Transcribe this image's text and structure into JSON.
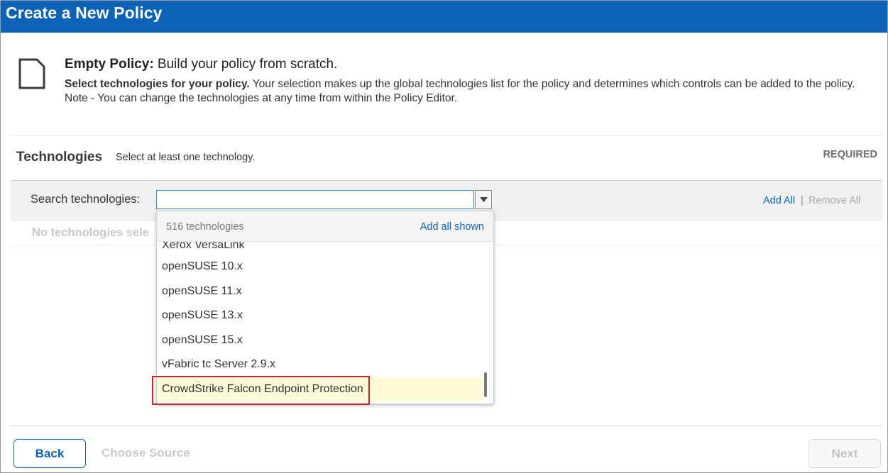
{
  "window": {
    "title": "Create a New Policy"
  },
  "intro": {
    "heading_bold": "Empty Policy:",
    "heading_rest": " Build your policy from scratch.",
    "body_bold": "Select technologies for your policy.",
    "body_rest": " Your selection makes up the global technologies list for the policy and determines which controls can be added to the policy. Note - You can change the technologies at any time from within the Policy Editor.",
    "icon": "document-icon"
  },
  "technologies": {
    "label": "Technologies",
    "hint": "Select at least one technology.",
    "required": "REQUIRED",
    "search_label": "Search technologies:",
    "search_value": "",
    "add_all": "Add All",
    "separator": "|",
    "remove_all": "Remove All",
    "empty_text": "No technologies sele"
  },
  "dropdown": {
    "count": "516 technologies",
    "add_all_shown": "Add all shown",
    "items": [
      "Xerox VersaLink",
      "openSUSE 10.x",
      "openSUSE 11.x",
      "openSUSE 13.x",
      "openSUSE 15.x",
      "vFabric tc Server 2.9.x",
      "CrowdStrike Falcon Endpoint Protection"
    ],
    "highlighted_index": 6
  },
  "footer": {
    "back": "Back",
    "choose_source": "Choose Source",
    "next": "Next"
  },
  "colors": {
    "brand": "#0b62b6",
    "highlight_row": "#fefbd8",
    "callout_border": "#d0212b"
  }
}
